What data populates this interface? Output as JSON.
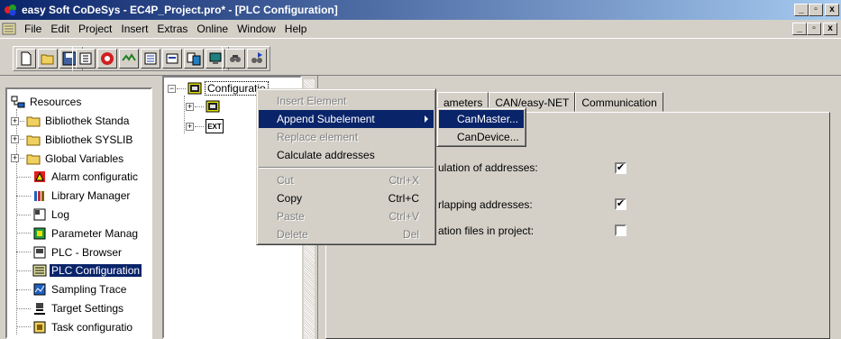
{
  "window": {
    "title": "easy Soft CoDeSys - EC4P_Project.pro* - [PLC Configuration]",
    "minimize": "_",
    "maximize": "▫",
    "close": "x"
  },
  "menubar": {
    "items": [
      "File",
      "Edit",
      "Project",
      "Insert",
      "Extras",
      "Online",
      "Window",
      "Help"
    ]
  },
  "toolbar": {
    "groups": [
      [
        "new-document",
        "open-folder",
        "save-disk"
      ],
      [
        "build-icon",
        "stop-red-circle",
        "step-icon",
        "list-icon",
        "chart-icon",
        "compare-icon",
        "monitor-icon"
      ],
      [
        "find-icon",
        "replace-icon"
      ]
    ]
  },
  "resources_tree": {
    "root": "Resources",
    "items": [
      {
        "label": "Bibliothek Standa",
        "icon": "folder-icon",
        "expandable": true
      },
      {
        "label": "Bibliothek SYSLIB",
        "icon": "folder-icon",
        "expandable": true
      },
      {
        "label": "Global Variables",
        "icon": "folder-icon",
        "expandable": true
      },
      {
        "label": "Alarm configuratic",
        "icon": "alarm-icon",
        "expandable": false
      },
      {
        "label": "Library Manager",
        "icon": "library-icon",
        "expandable": false
      },
      {
        "label": "Log",
        "icon": "log-icon",
        "expandable": false
      },
      {
        "label": "Parameter Manag",
        "icon": "parameter-icon",
        "expandable": false
      },
      {
        "label": "PLC - Browser",
        "icon": "browser-icon",
        "expandable": false
      },
      {
        "label": "PLC Configuration",
        "icon": "plc-config-icon",
        "expandable": false,
        "selected": true
      },
      {
        "label": "Sampling Trace",
        "icon": "trace-icon",
        "expandable": false
      },
      {
        "label": "Target Settings",
        "icon": "target-icon",
        "expandable": false
      },
      {
        "label": "Task configuratio",
        "icon": "task-icon",
        "expandable": false
      }
    ]
  },
  "config_tree": {
    "root": "Configuratio",
    "children": [
      {
        "label": "",
        "icon": "module-icon"
      },
      {
        "label": "",
        "icon": "ext-icon",
        "icon_text": "EXT"
      }
    ]
  },
  "tabs": [
    {
      "label": "ameters"
    },
    {
      "label": "CAN/easy-NET"
    },
    {
      "label": "Communication"
    }
  ],
  "options": [
    {
      "label": "ulation of addresses:",
      "checked": true
    },
    {
      "label": "rlapping addresses:",
      "checked": true
    },
    {
      "label": "ation files in project:",
      "checked": false
    }
  ],
  "context_menu": {
    "items": [
      {
        "label": "Insert Element",
        "disabled": true
      },
      {
        "label": "Append Subelement",
        "active": true,
        "submenu": true
      },
      {
        "label": "Replace element",
        "disabled": true
      },
      {
        "label": "Calculate addresses"
      },
      {
        "separator": true
      },
      {
        "label": "Cut",
        "shortcut": "Ctrl+X",
        "disabled": true
      },
      {
        "label": "Copy",
        "shortcut": "Ctrl+C"
      },
      {
        "label": "Paste",
        "shortcut": "Ctrl+V",
        "disabled": true
      },
      {
        "label": "Delete",
        "shortcut": "Del",
        "disabled": true
      }
    ]
  },
  "submenu": {
    "items": [
      {
        "label": "CanMaster...",
        "active": true
      },
      {
        "label": "CanDevice..."
      }
    ]
  },
  "colors": {
    "selection": "#0a246a",
    "face": "#d4d0c8"
  }
}
